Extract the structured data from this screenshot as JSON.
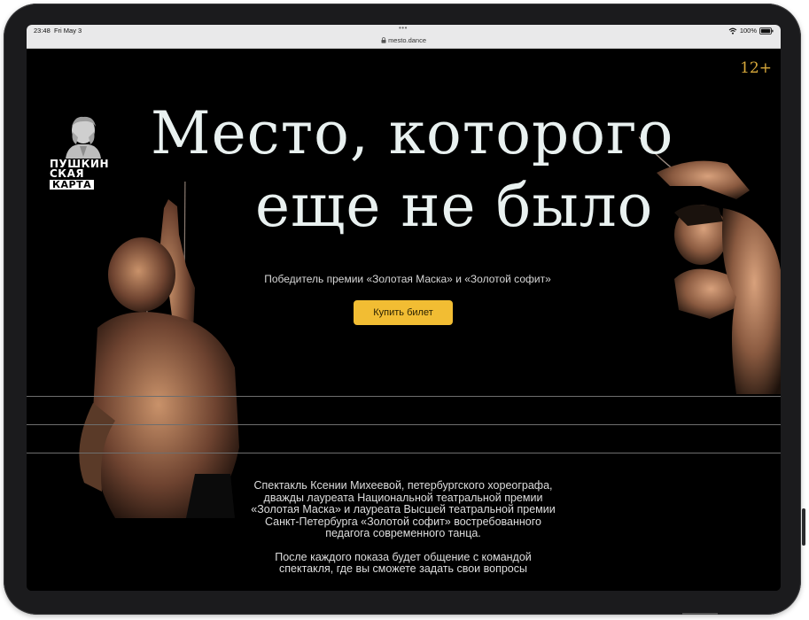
{
  "status": {
    "time": "23:48",
    "date": "Fri May 3",
    "battery": "100%",
    "icons": [
      "wifi-icon",
      "battery-icon"
    ]
  },
  "browser": {
    "url": "mesto.dance",
    "lock_icon": "lock-icon"
  },
  "header": {
    "logo_text_lines": [
      "ПУШКИН",
      "СКАЯ",
      "КАРТА"
    ],
    "age_rating": "12+"
  },
  "hero": {
    "title_line1": "Место, которого",
    "title_line2": "еще не было",
    "subtitle": "Победитель премии «Золотая Маска» и «Золотой софит»",
    "cta_label": "Купить билет"
  },
  "description": {
    "paragraph1": "Спектакль Ксении Михеевой, петербургского хореографа, дважды лауреата Национальной театральной премии «Золотая Маска» и лауреата Высшей театральной премии Санкт-Петербурга «Золотой софит» востребованного педагога современного танца.",
    "paragraph2": "После каждого показа будет общение с командой спектакля, где вы сможете задать свои вопросы"
  },
  "colors": {
    "accent": "#f2bd33",
    "age_rating": "#d6a73a",
    "title": "#e9f1f0",
    "background": "#000000"
  }
}
